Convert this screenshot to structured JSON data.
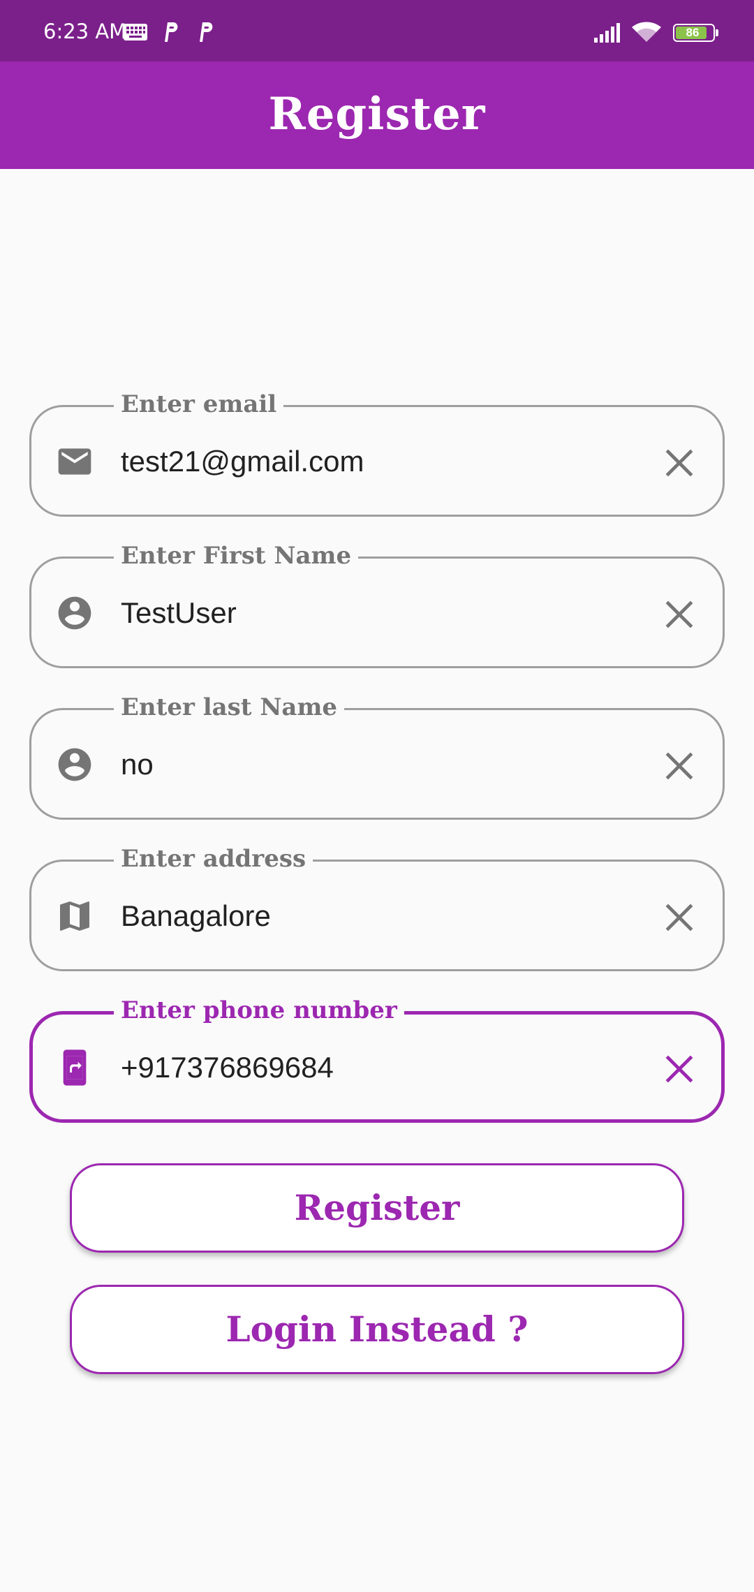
{
  "status_bar": {
    "time": "6:23 AM",
    "battery": "86",
    "icons": [
      "keyboard-icon",
      "p-notification-icon",
      "p-notification-icon",
      "signal-icon",
      "wifi-icon",
      "battery-icon"
    ]
  },
  "app_bar": {
    "title": "Register"
  },
  "form": {
    "fields": [
      {
        "label": "Enter email",
        "value": "test21@gmail.com",
        "icon": "email-icon"
      },
      {
        "label": "Enter First Name",
        "value": "TestUser",
        "icon": "person-icon"
      },
      {
        "label": "Enter last Name",
        "value": "no",
        "icon": "person-icon"
      },
      {
        "label": "Enter address",
        "value": "Banagalore",
        "icon": "map-icon"
      },
      {
        "label": "Enter phone number",
        "value": "+917376869684",
        "icon": "phone-forward-icon",
        "focused": true
      }
    ]
  },
  "buttons": {
    "register": "Register",
    "login": "Login Instead ?"
  },
  "colors": {
    "status_bar": "#7b1f8a",
    "primary": "#9c27b0",
    "outline": "#9e9e9e",
    "label": "#757575",
    "background": "#fafafa"
  }
}
